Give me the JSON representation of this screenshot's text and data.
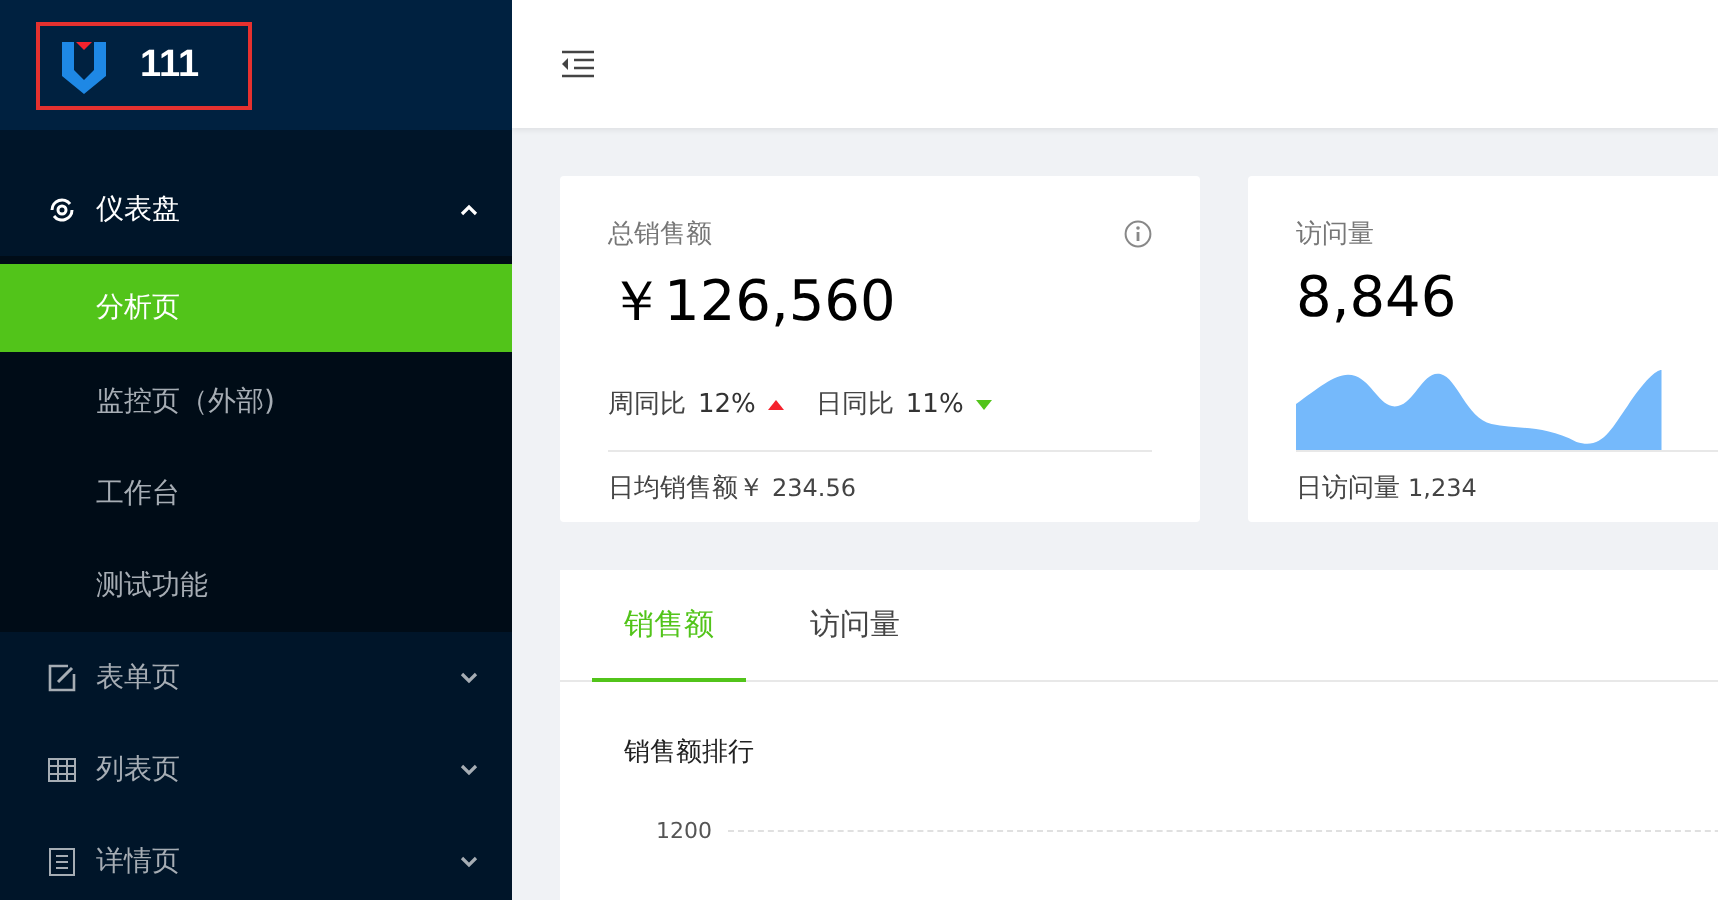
{
  "sidebar": {
    "logo_text": "111",
    "logo_highlighted": true,
    "menu": [
      {
        "label": "仪表盘",
        "kind": "dashboard",
        "expanded": true,
        "children": [
          {
            "label": "分析页",
            "selected": true
          },
          {
            "label": "监控页（外部)",
            "selected": false
          },
          {
            "label": "工作台",
            "selected": false
          },
          {
            "label": "测试功能",
            "selected": false
          }
        ]
      },
      {
        "label": "表单页",
        "kind": "form",
        "expanded": false
      },
      {
        "label": "列表页",
        "kind": "table",
        "expanded": false
      },
      {
        "label": "详情页",
        "kind": "profile",
        "expanded": false
      }
    ]
  },
  "stat_cards": [
    {
      "kind": "trend",
      "title": "总销售额",
      "value": "￥126,560",
      "trends": [
        {
          "label": "周同比",
          "value": "12%",
          "kind": "up"
        },
        {
          "label": "日同比",
          "value": "11%",
          "kind": "down"
        }
      ],
      "footer_label": "日均销售额￥",
      "footer_value": "234.56"
    },
    {
      "kind": "area",
      "title": "访问量",
      "value": "8,846",
      "footer_label": "日访问量",
      "footer_value": "1,234"
    }
  ],
  "tabs": [
    {
      "label": "销售额",
      "selected": true
    },
    {
      "label": "访问量",
      "selected": false
    }
  ],
  "chart_title": "销售额排行",
  "y_tick": "1200"
}
